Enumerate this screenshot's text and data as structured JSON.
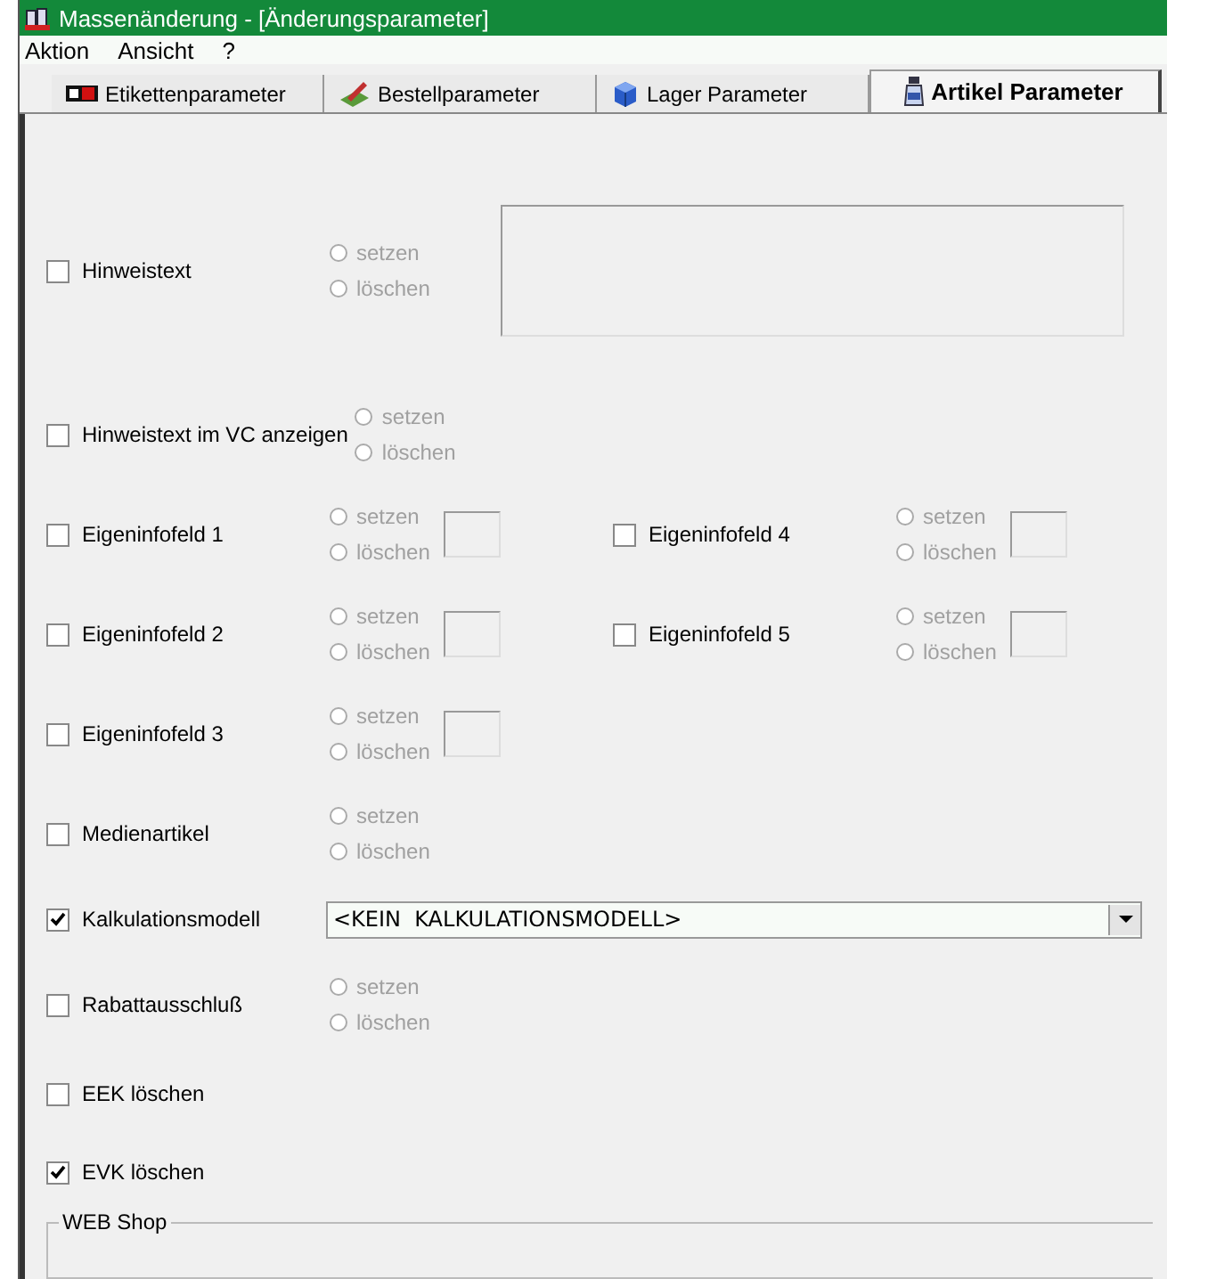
{
  "window": {
    "title": "Massenänderung - [Änderungsparameter]"
  },
  "menu": [
    "Aktion",
    "Ansicht",
    "?"
  ],
  "tabs": [
    {
      "label": "Etikettenparameter",
      "kind": "label",
      "selected": false
    },
    {
      "label": "Bestellparameter",
      "kind": "pencil",
      "selected": false
    },
    {
      "label": "Lager Parameter",
      "kind": "cube",
      "selected": false
    },
    {
      "label": "Artikel Parameter",
      "kind": "bottle",
      "selected": true
    }
  ],
  "rows": [
    {
      "kind": "memo",
      "items": [
        {
          "kind": "radio_memo",
          "label": "Hinweistext",
          "checked": false,
          "radios": [
            {
              "label": "setzen",
              "selected": false,
              "disabled": true
            },
            {
              "label": "löschen",
              "selected": false,
              "disabled": true
            }
          ]
        }
      ]
    },
    {
      "kind": "radio",
      "items": [
        {
          "kind": "radio",
          "label": "Hinweistext im VC anzeigen",
          "checked": false,
          "radios": [
            {
              "label": "setzen",
              "selected": false,
              "disabled": true
            },
            {
              "label": "löschen",
              "selected": false,
              "disabled": true
            }
          ]
        }
      ]
    },
    {
      "kind": "radio",
      "items": [
        {
          "kind": "radio_field",
          "label": "Eigeninfofeld 1",
          "checked": false,
          "radios": [
            {
              "label": "setzen",
              "selected": false,
              "disabled": true
            },
            {
              "label": "löschen",
              "selected": false,
              "disabled": true
            }
          ]
        },
        {
          "kind": "radio_field",
          "label": "Eigeninfofeld 4",
          "checked": false,
          "radios": [
            {
              "label": "setzen",
              "selected": false,
              "disabled": true
            },
            {
              "label": "löschen",
              "selected": false,
              "disabled": true
            }
          ]
        }
      ]
    },
    {
      "kind": "radio",
      "items": [
        {
          "kind": "radio_field",
          "label": "Eigeninfofeld 2",
          "checked": false,
          "radios": [
            {
              "label": "setzen",
              "selected": false,
              "disabled": true
            },
            {
              "label": "löschen",
              "selected": false,
              "disabled": true
            }
          ]
        },
        {
          "kind": "radio_field",
          "label": "Eigeninfofeld 5",
          "checked": false,
          "radios": [
            {
              "label": "setzen",
              "selected": false,
              "disabled": true
            },
            {
              "label": "löschen",
              "selected": false,
              "disabled": true
            }
          ]
        }
      ]
    },
    {
      "kind": "radio",
      "items": [
        {
          "kind": "radio_field",
          "label": "Eigeninfofeld 3",
          "checked": false,
          "radios": [
            {
              "label": "setzen",
              "selected": false,
              "disabled": true
            },
            {
              "label": "löschen",
              "selected": false,
              "disabled": true
            }
          ]
        }
      ]
    },
    {
      "kind": "radio",
      "items": [
        {
          "kind": "radio",
          "label": "Medienartikel",
          "checked": false,
          "radios": [
            {
              "label": "setzen",
              "selected": false,
              "disabled": true
            },
            {
              "label": "löschen",
              "selected": false,
              "disabled": true
            }
          ]
        }
      ]
    },
    {
      "kind": "combo",
      "items": [
        {
          "kind": "combo",
          "label": "Kalkulationsmodell",
          "checked": true,
          "value": "<KEIN  KALKULATIONSMODELL>"
        }
      ]
    },
    {
      "kind": "radio",
      "items": [
        {
          "kind": "radio",
          "label": "Rabattausschluß",
          "checked": false,
          "radios": [
            {
              "label": "setzen",
              "selected": false,
              "disabled": true
            },
            {
              "label": "löschen",
              "selected": false,
              "disabled": true
            }
          ]
        }
      ]
    },
    {
      "kind": "plain",
      "items": [
        {
          "kind": "plain",
          "label": "EEK löschen",
          "checked": false
        }
      ]
    },
    {
      "kind": "plain",
      "items": [
        {
          "kind": "plain",
          "label": "EVK löschen",
          "checked": true
        }
      ]
    }
  ],
  "group_box": {
    "title": "WEB Shop"
  }
}
